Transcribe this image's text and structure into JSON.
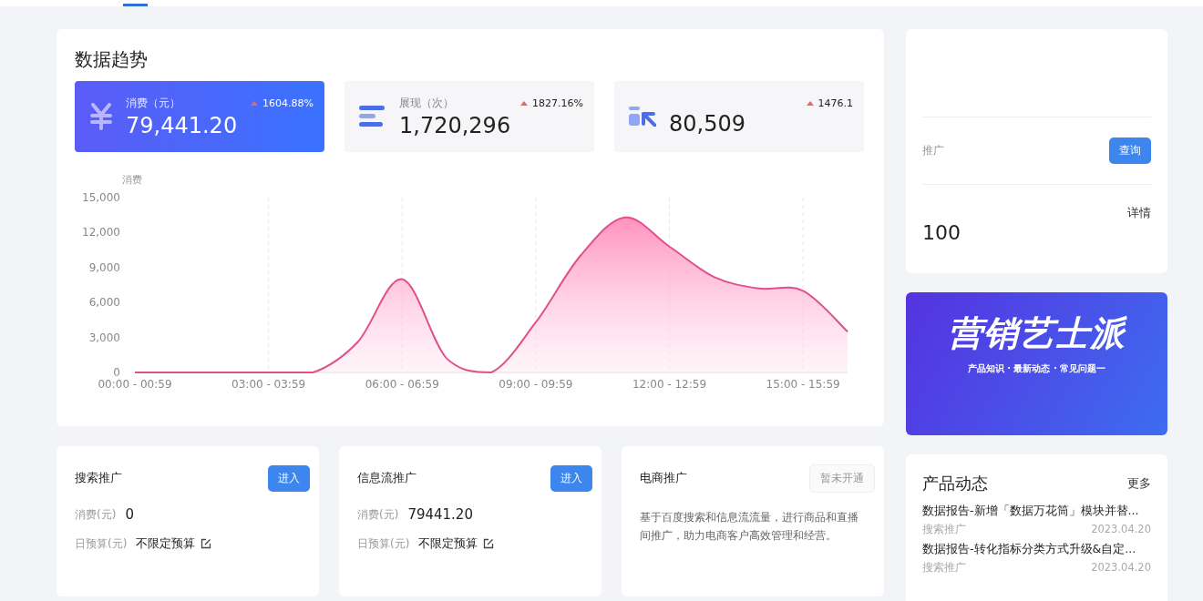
{
  "trend": {
    "title": "数据趋势",
    "metrics": [
      {
        "kind": "yuan",
        "label": "消费（元）",
        "value": "79,441.20",
        "change": "1604.88%",
        "selected": true
      },
      {
        "kind": "bars",
        "label": "展现（次）",
        "value": "1,720,296",
        "change": "1827.16%",
        "selected": false
      },
      {
        "kind": "click",
        "value": "80,509",
        "change": "1476.1",
        "selected": false
      }
    ],
    "chart_data": {
      "type": "area",
      "ylabel": "消费",
      "grid": true,
      "categories": [
        "00:00 - 00:59",
        null,
        null,
        "03:00 - 03:59",
        null,
        null,
        "06:00 - 06:59",
        null,
        null,
        "09:00 - 09:59",
        null,
        null,
        "12:00 - 12:59",
        null,
        null,
        "15:00 - 15:59",
        null
      ],
      "series": [
        {
          "color": "#e0508a",
          "values": [
            0,
            0,
            0,
            0,
            0,
            2600,
            8000,
            1200,
            0,
            4300,
            10000,
            13300,
            10800,
            8200,
            7200,
            7000,
            3500
          ]
        }
      ],
      "ylim": [
        0,
        15000
      ],
      "yticks": [
        {
          "value": 0,
          "label": "0"
        },
        {
          "value": 3000,
          "label": "3,000"
        },
        {
          "value": 6000,
          "label": "6,000"
        },
        {
          "value": 9000,
          "label": "9,000"
        },
        {
          "value": 12000,
          "label": "12,000"
        },
        {
          "value": 15000,
          "label": "15,000"
        }
      ]
    }
  },
  "account": {
    "label": "推广",
    "button": "查询",
    "detail_link": "详情",
    "value": "100"
  },
  "banner": {
    "title": "营销艺士派",
    "subtitle": "产品知识 · 最新动态 · 常见问题一"
  },
  "products": [
    {
      "title": "搜索推广",
      "button": "进入",
      "disabled": false,
      "spend_label": "消费(元)",
      "spend": "0",
      "budget_label": "日预算(元)",
      "budget": "不限定预算"
    },
    {
      "title": "信息流推广",
      "button": "进入",
      "disabled": false,
      "spend_label": "消费(元)",
      "spend": "79441.20",
      "budget_label": "日预算(元)",
      "budget": "不限定预算"
    },
    {
      "title": "电商推广",
      "button": "暂未开通",
      "disabled": true,
      "description": "基于百度搜索和信息流流量，进行商品和直播间推广，助力电商客户高效管理和经营。"
    }
  ],
  "news": {
    "title": "产品动态",
    "more": "更多",
    "items": [
      {
        "title": "数据报告-新增「数据万花筒」模块并替...",
        "tag": "搜索推广",
        "date": "2023.04.20"
      },
      {
        "title": "数据报告-转化指标分类方式升级&自定...",
        "tag": "搜索推广",
        "date": "2023.04.20"
      }
    ]
  }
}
